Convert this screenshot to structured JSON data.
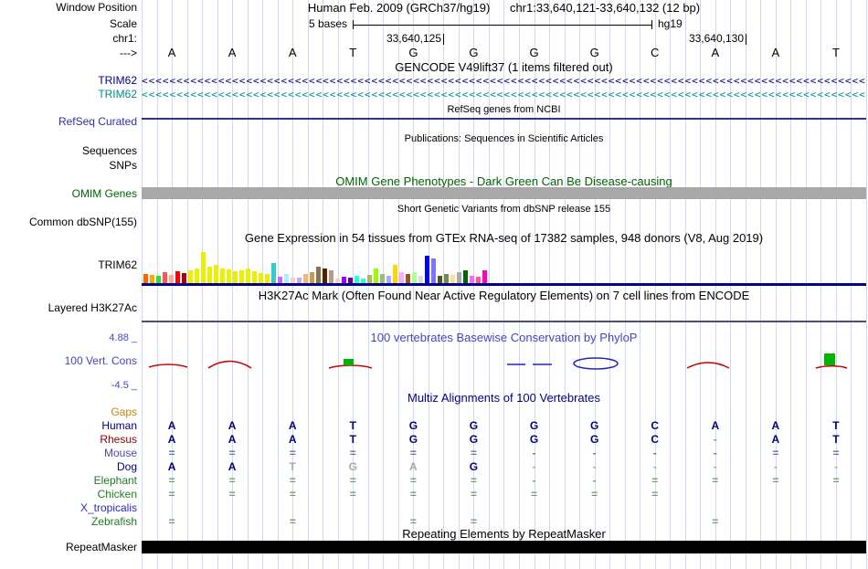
{
  "sidebar": {
    "window_position": "Window Position",
    "scale": "Scale",
    "chrom": "chr1:",
    "direction": "--->",
    "gencode_item1": "TRIM62",
    "gencode_item2": "TRIM62",
    "refseq": "RefSeq Curated",
    "sequences": "Sequences",
    "snps": "SNPs",
    "omim": "OMIM Genes",
    "dbsnp": "Common dbSNP(155)",
    "gtex": "TRIM62",
    "h3k27ac": "Layered H3K27Ac",
    "cons_max": "4.88 _",
    "cons_label": "100 Vert. Cons",
    "cons_min": "-4.5 _",
    "repeatmasker": "RepeatMasker"
  },
  "ruler": {
    "assembly": "Human Feb. 2009 (GRCh37/hg19)",
    "position": "chr1:33,640,121-33,640,132 (12 bp)",
    "scale_text": "5 bases",
    "assembly_tag": "hg19",
    "coord_left": "33,640,125",
    "coord_right": "33,640,130",
    "bases": [
      "A",
      "A",
      "A",
      "T",
      "G",
      "G",
      "G",
      "G",
      "C",
      "A",
      "A",
      "T"
    ]
  },
  "titles": {
    "gencode": "GENCODE V49lift37 (1 items filtered out)",
    "refseq": "RefSeq genes from NCBI",
    "publications": "Publications: Sequences in Scientific Articles",
    "omim": "OMIM Gene Phenotypes - Dark Green Can Be Disease-causing",
    "dbsnp": "Short Genetic Variants from dbSNP release 155",
    "gtex": "Gene Expression in 54 tissues from GTEx RNA-seq of 17382 samples, 948 donors (V8, Aug 2019)",
    "h3k27ac": "H3K27Ac Mark (Often Found Near Active Regulatory Elements) on 7 cell lines from ENCODE",
    "phylop": "100 vertebrates Basewise Conservation by PhyloP",
    "multiz": "Multiz Alignments of 100 Vertebrates",
    "repeatmasker": "Repeating Elements by RepeatMasker"
  },
  "gencode": {
    "arrow_char": "<",
    "arrow_count": 104,
    "items": [
      {
        "label": "TRIM62",
        "color": "#00008B"
      },
      {
        "label": "TRIM62",
        "color": "#008B8B"
      }
    ]
  },
  "gtex": {
    "bars": [
      [
        10,
        "#FF6600"
      ],
      [
        9,
        "#FFAA00"
      ],
      [
        8,
        "#33DD33"
      ],
      [
        12,
        "#FF5555"
      ],
      [
        9,
        "#FFAA99"
      ],
      [
        13,
        "#FF0000"
      ],
      [
        11,
        "#AA0000"
      ],
      [
        14,
        "#EEEE00"
      ],
      [
        16,
        "#EEEE00"
      ],
      [
        34,
        "#EEEE00"
      ],
      [
        18,
        "#EEEE00"
      ],
      [
        20,
        "#EEEE00"
      ],
      [
        16,
        "#EEEE00"
      ],
      [
        15,
        "#EEEE00"
      ],
      [
        13,
        "#EEEE00"
      ],
      [
        14,
        "#EEEE00"
      ],
      [
        16,
        "#EEEE00"
      ],
      [
        13,
        "#EEEE00"
      ],
      [
        11,
        "#EEEE00"
      ],
      [
        10,
        "#EEEE00"
      ],
      [
        22,
        "#33CCCC"
      ],
      [
        7,
        "#CC66FF"
      ],
      [
        10,
        "#AAEEFF"
      ],
      [
        6,
        "#FFCCCC"
      ],
      [
        6,
        "#CCAADD"
      ],
      [
        10,
        "#EEBB77"
      ],
      [
        12,
        "#CC9955"
      ],
      [
        18,
        "#8B7355"
      ],
      [
        16,
        "#552200"
      ],
      [
        14,
        "#BB9988"
      ],
      [
        5,
        "#FFCCCC"
      ],
      [
        7,
        "#9900FF"
      ],
      [
        6,
        "#660099"
      ],
      [
        8,
        "#22FFDD"
      ],
      [
        5,
        "#33FFC2"
      ],
      [
        9,
        "#AABB66"
      ],
      [
        16,
        "#99FF00"
      ],
      [
        10,
        "#99BB88"
      ],
      [
        8,
        "#AAAAFF"
      ],
      [
        20,
        "#FFD700"
      ],
      [
        12,
        "#FFAAFF"
      ],
      [
        10,
        "#995522"
      ],
      [
        12,
        "#AAFF99"
      ],
      [
        8,
        "#DDDDDD"
      ],
      [
        30,
        "#0000FF"
      ],
      [
        27,
        "#7777FF"
      ],
      [
        8,
        "#555522"
      ],
      [
        10,
        "#778855"
      ],
      [
        9,
        "#FFDD99"
      ],
      [
        12,
        "#AAAAAA"
      ],
      [
        14,
        "#006600"
      ],
      [
        8,
        "#FF66FF"
      ],
      [
        7,
        "#FF5599"
      ],
      [
        14,
        "#FF00BB"
      ]
    ]
  },
  "multiz": {
    "species": [
      {
        "name": "Gaps",
        "color": "#C8860A",
        "cell_color": "#C8860A",
        "cells": [
          "",
          "",
          "",
          "",
          "",
          "",
          "",
          "",
          "",
          "",
          "",
          ""
        ]
      },
      {
        "name": "Human",
        "color": "#000080",
        "cell_color": "#000080",
        "cells": [
          "A",
          "A",
          "A",
          "T",
          "G",
          "G",
          "G",
          "G",
          "C",
          "A",
          "A",
          "T"
        ]
      },
      {
        "name": "Rhesus",
        "color": "#8B0000",
        "cell_color": "#000080",
        "cells": [
          "A",
          "A",
          "A",
          "T",
          "G",
          "G",
          "G",
          "G",
          "C",
          "-",
          "A",
          "T"
        ],
        "cell_colors": [
          "#000080",
          "#000080",
          "#000080",
          "#000080",
          "#000080",
          "#000080",
          "#000080",
          "#000080",
          "#000080",
          "#909090",
          "#000080",
          "#000080"
        ]
      },
      {
        "name": "Mouse",
        "color": "#4B4BA8",
        "cell_color": "#7070A8",
        "cells": [
          "=",
          "=",
          "=",
          "=",
          "=",
          "=",
          "-",
          "-",
          "-",
          "-",
          "=",
          "="
        ]
      },
      {
        "name": "Dog",
        "color": "#000080",
        "cell_color": "#000080",
        "cells": [
          "A",
          "A",
          "T",
          "G",
          "A",
          "G",
          "-",
          "-",
          "-",
          "-",
          "-",
          "-"
        ],
        "cell_colors": [
          "#000080",
          "#000080",
          "#A8A8A8",
          "#A8A8A8",
          "#A8A8A8",
          "#000080",
          "#A8A8A8",
          "#A8A8A8",
          "#A8A8A8",
          "#A8A8A8",
          "#A8A8A8",
          "#A8A8A8"
        ]
      },
      {
        "name": "Elephant",
        "color": "#1F7A1F",
        "cell_color": "#7F9A7A",
        "cells": [
          "=",
          "=",
          "=",
          "=",
          "=",
          "=",
          "-",
          "-",
          "=",
          "=",
          "=",
          "="
        ]
      },
      {
        "name": "Chicken",
        "color": "#1F7A1F",
        "cell_color": "#7F9A7A",
        "cells": [
          "=",
          "=",
          "=",
          "=",
          "=",
          "=",
          "=",
          "=",
          "=",
          "",
          "",
          ""
        ]
      },
      {
        "name": "X_tropicalis",
        "color": "#2B2BC0",
        "cell_color": "#7F9A7A",
        "cells": [
          "",
          "",
          "",
          "",
          "",
          "",
          "",
          "",
          "",
          "",
          "",
          ""
        ]
      },
      {
        "name": "Zebrafish",
        "color": "#1F7A1F",
        "cell_color": "#7F9A7A",
        "cells": [
          "=",
          "",
          "=",
          "",
          "=",
          "=",
          "",
          "",
          "",
          "=",
          "",
          ""
        ]
      }
    ]
  },
  "colors": {
    "guideline": "#CEDAEF",
    "refseq_line": "#2E2EA8",
    "omim_bar": "#A8A8A8",
    "gtex_baseline": "#00008B",
    "h3k27ac_line": "#4A4A7E",
    "phylop_title": "#4444C8",
    "multiz_title": "#00008B",
    "omim_green": "#006400",
    "repeat_bar": "#000000"
  }
}
